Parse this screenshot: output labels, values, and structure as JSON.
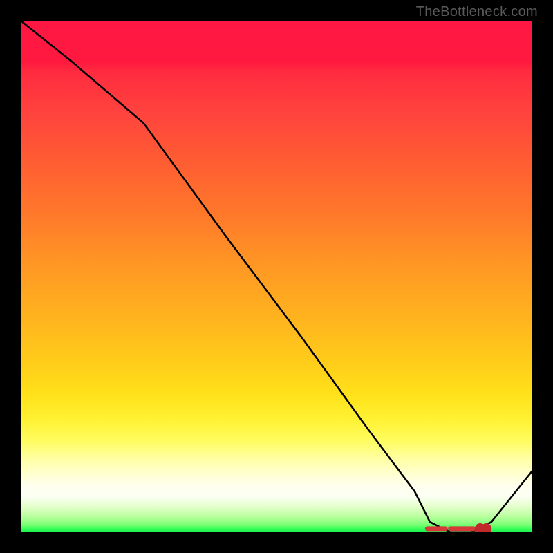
{
  "watermark": "TheBottleneck.com",
  "chart_data": {
    "type": "line",
    "title": "",
    "xlabel": "",
    "ylabel": "",
    "xlim": [
      0,
      100
    ],
    "ylim": [
      0,
      100
    ],
    "grid": false,
    "legend": false,
    "series": [
      {
        "name": "bottleneck-curve",
        "x": [
          0,
          10,
          24,
          40,
          55,
          68,
          77,
          80,
          84,
          88,
          92,
          100
        ],
        "y": [
          100,
          92,
          80,
          58,
          38,
          20,
          8,
          2,
          0,
          0,
          2,
          12
        ]
      }
    ],
    "markers": {
      "y": 0.7,
      "segments": [
        {
          "x0": 79.5,
          "x1": 83.0
        },
        {
          "x0": 84.0,
          "x1": 88.5
        }
      ],
      "dots_x": [
        89.8,
        91.0
      ]
    }
  }
}
